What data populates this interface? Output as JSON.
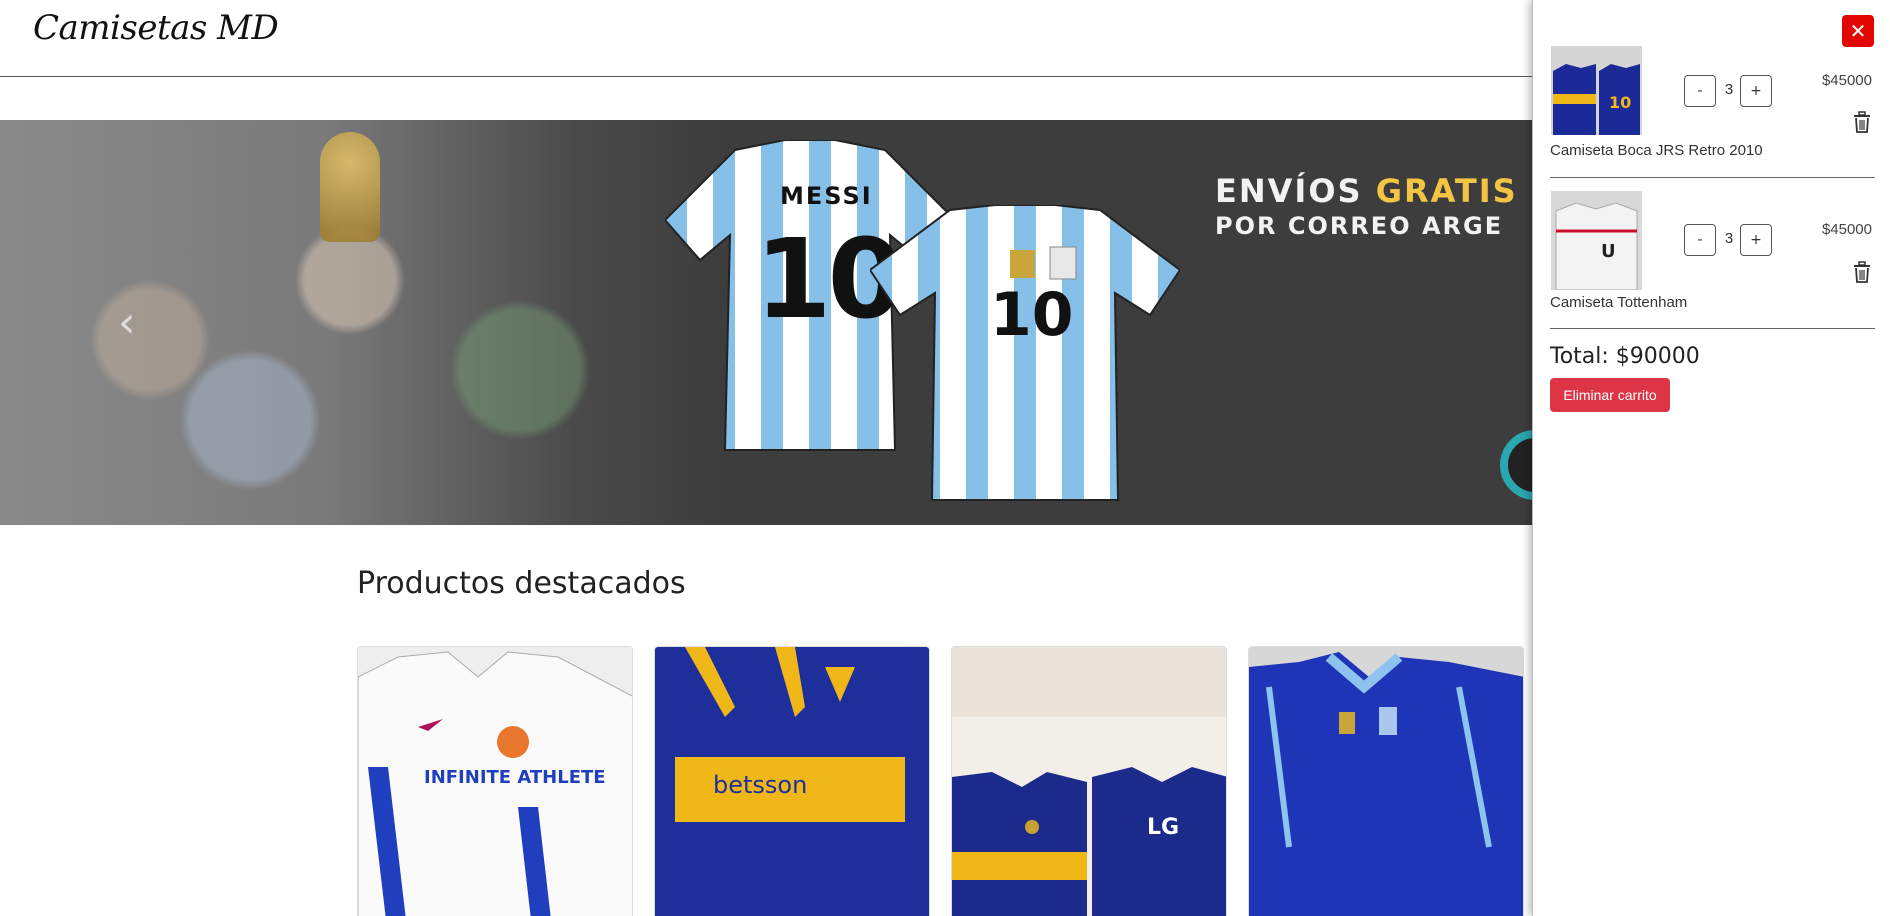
{
  "header": {
    "brand": "Camisetas MD"
  },
  "hero": {
    "jersey_name": "MESSI",
    "jersey_number": "10",
    "promo_line1_part1": "ENVÍOS ",
    "promo_line1_part2": "GRATIS",
    "promo_line2": "POR CORREO ARGE",
    "prev_icon": "chevron-left-icon"
  },
  "products": {
    "title": "Productos destacados",
    "cards": [
      {
        "text": "INFINITE ATHLETE"
      },
      {
        "text": "betsson"
      },
      {
        "text": "LG"
      },
      {
        "text": ""
      }
    ]
  },
  "cart": {
    "close_label": "✕",
    "items": [
      {
        "name": "Camiseta Boca JRS Retro 2010",
        "qty": "3",
        "price": "$45000",
        "minus": "-",
        "plus": "+"
      },
      {
        "name": "Camiseta Tottenham",
        "qty": "3",
        "price": "$45000",
        "minus": "-",
        "plus": "+"
      }
    ],
    "total": "Total: $90000",
    "clear_label": "Eliminar carrito"
  },
  "colors": {
    "accent_red": "#dc3545",
    "close_red": "#e10600",
    "hero_bg": "#3d3d3d",
    "gold": "#f4c542"
  }
}
